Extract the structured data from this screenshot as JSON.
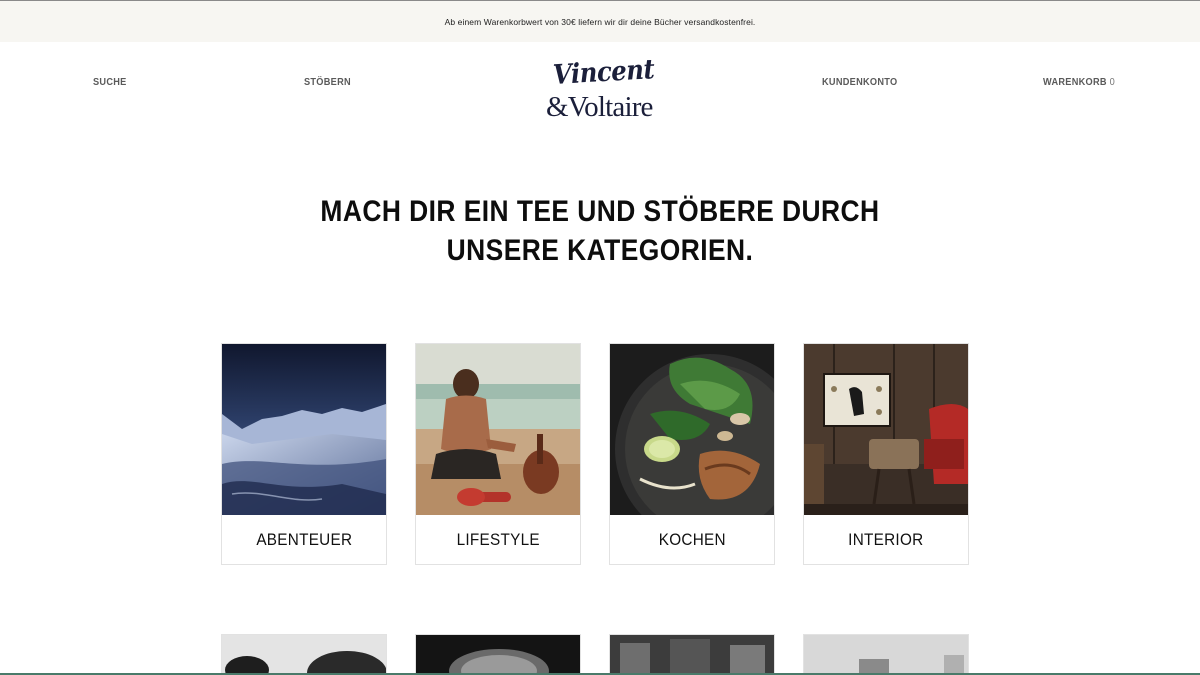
{
  "banner": {
    "text": "Ab einem Warenkorbwert von 30€ liefern wir dir deine Bücher versandkostenfrei."
  },
  "nav": {
    "search": "SUCHE",
    "browse": "STÖBERN",
    "account": "KUNDENKONTO",
    "cart": "WARENKORB",
    "cart_count": "0"
  },
  "logo": {
    "line1": "Vincent",
    "line2": "&Voltaire"
  },
  "headline": {
    "line1": "MACH DIR EIN TEE UND STÖBERE DURCH",
    "line2": "UNSERE KATEGORIEN."
  },
  "categories": [
    {
      "label": "ABENTEUER",
      "image": "snowy-mountains-photo"
    },
    {
      "label": "LIFESTYLE",
      "image": "beach-ukulele-photo"
    },
    {
      "label": "KOCHEN",
      "image": "food-plate-photo"
    },
    {
      "label": "INTERIOR",
      "image": "vintage-interior-photo"
    }
  ],
  "colors": {
    "banner_bg": "#f7f6f2",
    "logo": "#1b1f3a",
    "nav_text": "#5a5a5a",
    "headline": "#0d0d0d"
  }
}
